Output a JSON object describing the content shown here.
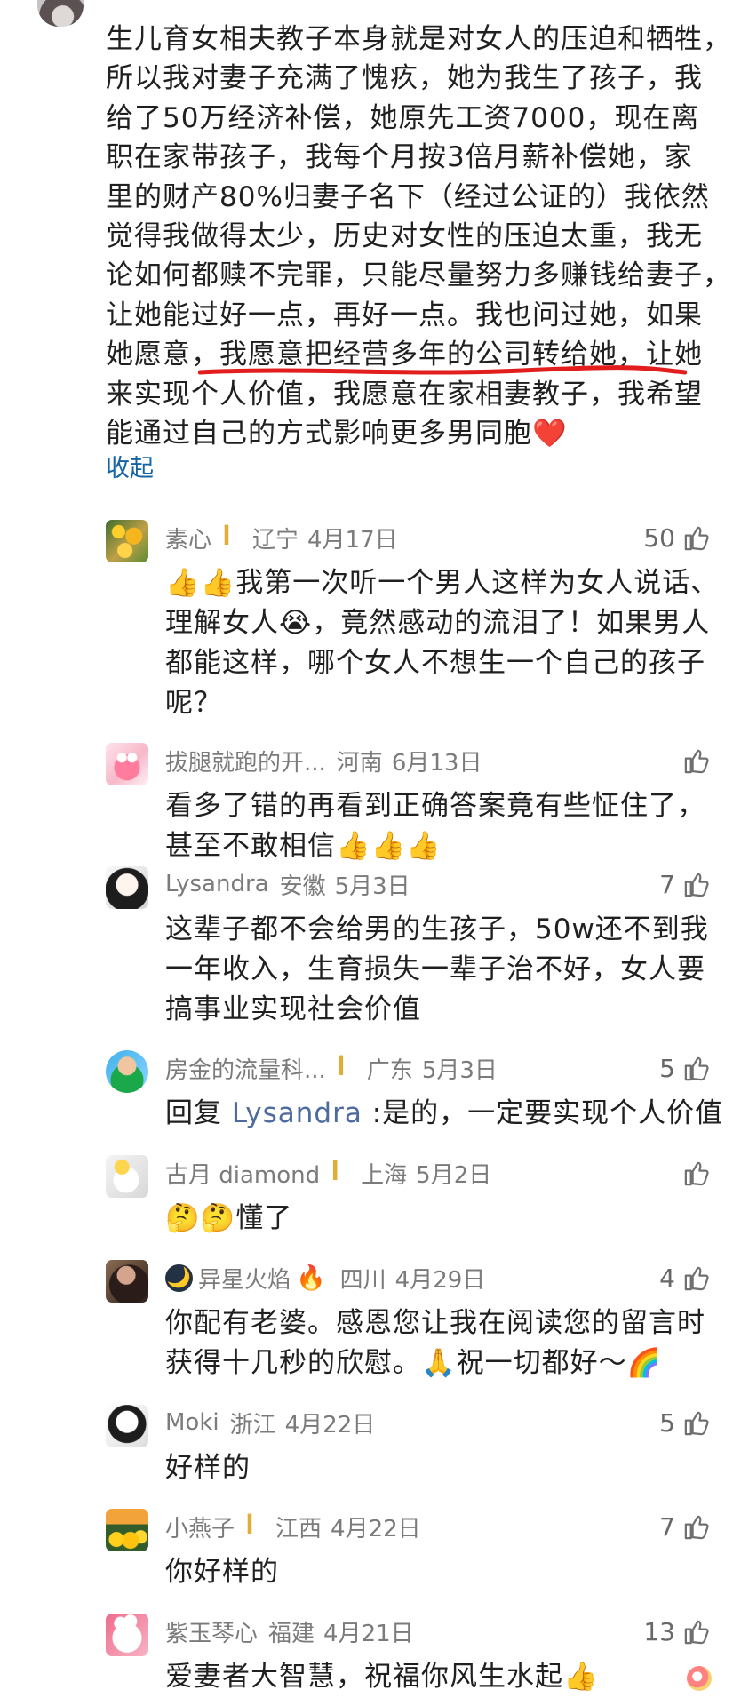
{
  "colors": {
    "background": "#ffffff",
    "text": "#202020",
    "meta": "#7b7b7b",
    "link": "#1464a5",
    "underline": "#e11d1d",
    "reply_name": "#4e6b9e"
  },
  "post": {
    "lines": [
      "生儿育女相夫教子本身就是对女人的压迫和牺牲，",
      "所以我对妻子充满了愧疚，她为我生了孩子，我",
      "给了50万经济补偿，她原先工资7000，现在离",
      "职在家带孩子，我每个月按3倍月薪补偿她，家",
      "里的财产80%归妻子名下（经过公证的）我依然",
      "觉得我做得太少，历史对女性的压迫太重，我无",
      "论如何都赎不完罪，只能尽量努力多赚钱给妻子，",
      "让她能过好一点，再好一点。我也问过她，如果",
      "她愿意，我愿意把经营多年的公司转给她，让她",
      "来实现个人价值，我愿意在家相妻教子，我希望",
      "能通过自己的方式影响更多男同胞❤️"
    ],
    "collapse_label": "收起"
  },
  "comments": [
    {
      "avatar_icon": "flower-avatar-icon",
      "username": "素心",
      "verified_icon": "ꟾ",
      "location": "辽宁",
      "date": "4月17日",
      "likes": "50",
      "lines": [
        "👍👍我第一次听一个男人这样为女人说话、",
        "理解女人😭，竟然感动的流泪了！如果男人",
        "都能这样，哪个女人不想生一个自己的孩子",
        "呢？"
      ]
    },
    {
      "avatar_icon": "pink-character-avatar-icon",
      "username": "拔腿就跑的开...",
      "location": "河南",
      "date": "6月13日",
      "likes": "",
      "lines": [
        "看多了错的再看到正确答案竟有些怔住了，",
        "甚至不敢相信👍👍👍"
      ]
    },
    {
      "avatar_icon": "girl-avatar-icon",
      "username": "Lysandra",
      "location": "安徽",
      "date": "5月3日",
      "likes": "7",
      "lines": [
        "这辈子都不会给男的生孩子，50w还不到我",
        "一年收入，生育损失一辈子治不好，女人要",
        "搞事业实现社会价值"
      ]
    },
    {
      "avatar_icon": "man-avatar-icon",
      "username": "房金的流量科...",
      "verified_icon": "ꟾ",
      "location": "广东",
      "date": "5月3日",
      "likes": "5",
      "reply_prefix": "回复 ",
      "reply_name": "Lysandra",
      "reply_text": " :是的，一定要实现个人价值"
    },
    {
      "avatar_icon": "cartoon-avatar-icon",
      "username": "古月 diamond",
      "verified_icon": "ꟾ",
      "location": "上海",
      "date": "5月2日",
      "likes": "",
      "lines": [
        "🤔🤔懂了"
      ]
    },
    {
      "avatar_icon": "dark-portrait-avatar-icon",
      "username_prefix_icon": "🌙",
      "username": "异星火焰",
      "username_suffix_icon": "🔥",
      "location": "四川",
      "date": "4月29日",
      "likes": "4",
      "lines": [
        "你配有老婆。感恩您让我在阅读您的留言时",
        "获得十几秒的欣慰。🙏祝一切都好～🌈"
      ]
    },
    {
      "avatar_icon": "sketch-avatar-icon",
      "username": "Moki",
      "location": "浙江",
      "date": "4月22日",
      "likes": "5",
      "lines": [
        "好样的"
      ]
    },
    {
      "avatar_icon": "sunflower-avatar-icon",
      "username": "小燕子",
      "verified_icon": "ꟾ",
      "location": "江西",
      "date": "4月22日",
      "likes": "7",
      "lines": [
        "你好样的"
      ]
    },
    {
      "avatar_icon": "rabbit-avatar-icon",
      "username": "紫玉琴心",
      "location": "福建",
      "date": "4月21日",
      "likes": "13",
      "lines": [
        "爱妻者大智慧，祝福你风生水起👍"
      ]
    }
  ]
}
